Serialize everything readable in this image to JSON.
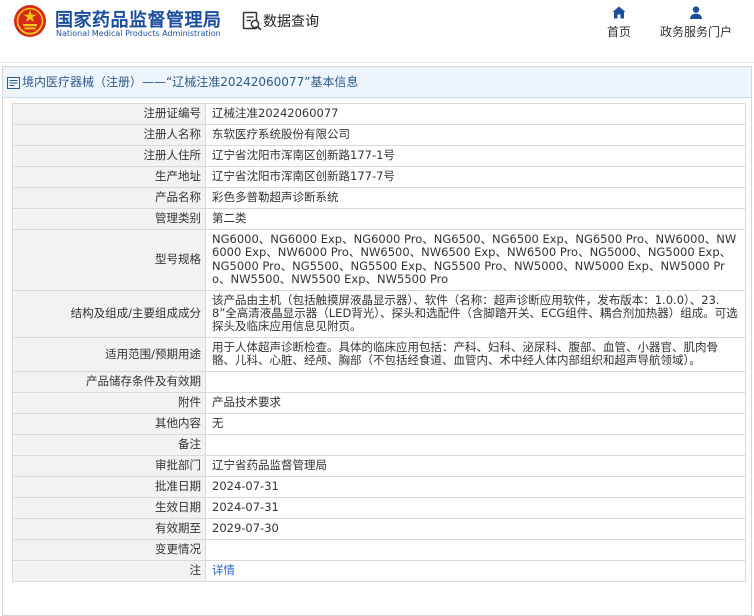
{
  "header": {
    "site_name": "国家药品监督管理局",
    "site_name_en": "National Medical Products Administration",
    "query_label": "数据查询",
    "nav": [
      {
        "label": "首页",
        "icon": "home-icon"
      },
      {
        "label": "政务服务门户",
        "icon": "user-icon"
      }
    ]
  },
  "panel": {
    "title": "境内医疗器械（注册）——“辽械注准20242060077”基本信息"
  },
  "fields": [
    {
      "label": "注册证编号",
      "value": "辽械注准20242060077"
    },
    {
      "label": "注册人名称",
      "value": "东软医疗系统股份有限公司"
    },
    {
      "label": "注册人住所",
      "value": "辽宁省沈阳市浑南区创新路177-1号"
    },
    {
      "label": "生产地址",
      "value": "辽宁省沈阳市浑南区创新路177-7号"
    },
    {
      "label": "产品名称",
      "value": "彩色多普勒超声诊断系统"
    },
    {
      "label": "管理类别",
      "value": "第二类"
    },
    {
      "label": "型号规格",
      "value": "NG6000、NG6000 Exp、NG6000 Pro、NG6500、NG6500 Exp、NG6500 Pro、NW6000、NW6000 Exp、NW6000 Pro、NW6500、NW6500 Exp、NW6500 Pro、NG5000、NG5000 Exp、NG5000 Pro、NG5500、NG5500 Exp、NG5500 Pro、NW5000、NW5000 Exp、NW5000 Pro、NW5500、NW5500 Exp、NW5500 Pro"
    },
    {
      "label": "结构及组成/主要组成成分",
      "value": "该产品由主机（包括触摸屏液晶显示器）、软件（名称：超声诊断应用软件，发布版本：1.0.0）、23.8”全高清液晶显示器（LED背光）、探头和选配件（含脚踏开关、ECG组件、耦合剂加热器）组成。可选探头及临床应用信息见附页。"
    },
    {
      "label": "适用范围/预期用途",
      "value": "用于人体超声诊断检查。具体的临床应用包括：产科、妇科、泌尿科、腹部、血管、小器官、肌肉骨骼、儿科、心脏、经颅、胸部（不包括经食道、血管内、术中经人体内部组织和超声导航领域）。"
    },
    {
      "label": "产品储存条件及有效期",
      "value": ""
    },
    {
      "label": "附件",
      "value": "产品技术要求"
    },
    {
      "label": "其他内容",
      "value": "无"
    },
    {
      "label": "备注",
      "value": ""
    },
    {
      "label": "审批部门",
      "value": "辽宁省药品监督管理局"
    },
    {
      "label": "批准日期",
      "value": "2024-07-31"
    },
    {
      "label": "生效日期",
      "value": "2024-07-31"
    },
    {
      "label": "有效期至",
      "value": "2029-07-30"
    },
    {
      "label": "变更情况",
      "value": ""
    },
    {
      "label": "注",
      "value": "详情",
      "value_is_link": true,
      "value_color": "#2a62c9"
    }
  ],
  "colors": {
    "brand": "#1b4f9c",
    "label_bg": "#f2f2f2",
    "title_bar_bg": "#eef4fb",
    "link": "#2a62c9"
  }
}
